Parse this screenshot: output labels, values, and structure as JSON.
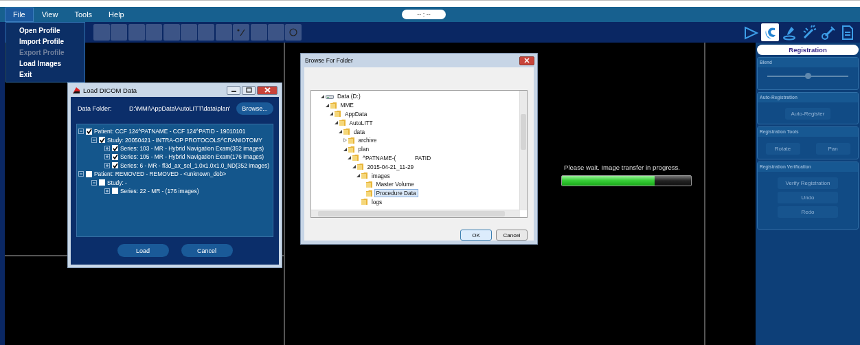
{
  "menu_bar": {
    "items": [
      {
        "label": "File",
        "selected": true
      },
      {
        "label": "View",
        "selected": false
      },
      {
        "label": "Tools",
        "selected": false
      },
      {
        "label": "Help",
        "selected": false
      }
    ],
    "clock": "-- : --"
  },
  "file_menu": {
    "items": [
      {
        "label": "Open Profile",
        "disabled": false
      },
      {
        "label": "Import Profile",
        "disabled": false
      },
      {
        "label": "Export Profile",
        "disabled": true
      },
      {
        "label": "Load Images",
        "disabled": false
      },
      {
        "label": "Exit",
        "disabled": false
      }
    ]
  },
  "toolbar": {
    "tools": [
      {
        "kind": "blank"
      },
      {
        "kind": "blank"
      },
      {
        "kind": "blank"
      },
      {
        "kind": "blank"
      },
      {
        "kind": "blank"
      },
      {
        "kind": "blank"
      },
      {
        "kind": "blank"
      },
      {
        "kind": "blank"
      },
      {
        "kind": "line"
      },
      {
        "kind": "blank"
      },
      {
        "kind": "blank"
      },
      {
        "kind": "circle"
      }
    ],
    "modes": [
      {
        "kind": "play",
        "selected": false
      },
      {
        "kind": "registration",
        "selected": true
      },
      {
        "kind": "pen",
        "selected": false
      },
      {
        "kind": "wand",
        "selected": false
      },
      {
        "kind": "probe",
        "selected": false
      },
      {
        "kind": "document",
        "selected": false
      }
    ]
  },
  "load_dicom_dialog": {
    "title": "Load DICOM Data",
    "data_folder_label": "Data Folder:",
    "data_folder": "D:\\MMI\\AppData\\AutoLITT\\data\\plan'",
    "browse_button": "Browse...",
    "tree": [
      {
        "label": "Patient: CCF 124^PATNAME - CCF 124^PATID - 19010101",
        "checked": true,
        "expanded": true,
        "children": [
          {
            "label": "Study: 20050421 - INTRA-OP PROTOCOLS^CRANIOTOMY",
            "checked": true,
            "expanded": true,
            "children": [
              {
                "label": "Series: 103 - MR - Hybrid Navigation Exam(352 images)",
                "checked": true,
                "expanded": false
              },
              {
                "label": "Series: 105 - MR - Hybrid Navigation Exam(176 images)",
                "checked": true,
                "expanded": false
              },
              {
                "label": "Series: 6 - MR - fl3d_ax_sel_1.0x1.0x1.0_ND(352 images)",
                "checked": true,
                "expanded": false
              }
            ]
          }
        ]
      },
      {
        "label": "Patient: REMOVED - REMOVED - <unknown_dob>",
        "checked": false,
        "expanded": true,
        "children": [
          {
            "label": "Study:  -",
            "checked": false,
            "expanded": true,
            "children": [
              {
                "label": "Series: 22 - MR - (176 images)",
                "checked": false,
                "expanded": false
              }
            ]
          }
        ]
      }
    ],
    "buttons": [
      "Load",
      "Cancel"
    ]
  },
  "browse_dialog": {
    "title": "Browse For Folder",
    "tree": [
      {
        "label": "Data (D:)",
        "kind": "drive",
        "expanded": true,
        "selected": false,
        "children": [
          {
            "label": "MME",
            "kind": "folder",
            "expanded": true,
            "selected": false,
            "children": [
              {
                "label": "AppData",
                "kind": "folder",
                "expanded": true,
                "selected": false,
                "children": [
                  {
                    "label": "AutoLITT",
                    "kind": "folder",
                    "expanded": true,
                    "selected": false,
                    "children": [
                      {
                        "label": "data",
                        "kind": "folder",
                        "expanded": true,
                        "selected": false,
                        "children": [
                          {
                            "label": "archive",
                            "kind": "folder",
                            "expanded": false,
                            "selected": false
                          },
                          {
                            "label": "plan",
                            "kind": "folder",
                            "expanded": true,
                            "selected": false,
                            "children": [
                              {
                                "label": "^PATNAME-(            PATID",
                                "kind": "folder",
                                "expanded": true,
                                "selected": false,
                                "children": [
                                  {
                                    "label": "2015-04-21_11-29",
                                    "kind": "folder",
                                    "expanded": true,
                                    "selected": false,
                                    "children": [
                                      {
                                        "label": "images",
                                        "kind": "folder",
                                        "expanded": true,
                                        "selected": false,
                                        "children": [
                                          {
                                            "label": "Master Volume",
                                            "kind": "folder",
                                            "selected": false
                                          },
                                          {
                                            "label": "Procedure Data",
                                            "kind": "folder",
                                            "selected": true
                                          }
                                        ]
                                      },
                                      {
                                        "label": "logs",
                                        "kind": "folder",
                                        "selected": false
                                      }
                                    ]
                                  }
                                ]
                              }
                            ]
                          }
                        ]
                      }
                    ]
                  }
                ]
              }
            ]
          }
        ]
      }
    ],
    "buttons": [
      "OK",
      "Cancel"
    ]
  },
  "transfer": {
    "message": "Please wait. Image transfer in progress.",
    "level": 0.72
  },
  "registration_panel": {
    "title": "Registration",
    "sections": [
      {
        "title": "Blend",
        "kind": "slider",
        "level": 0.5
      },
      {
        "title": "Auto-Registration",
        "kind": "buttons",
        "buttons": [
          {
            "label": "Auto-Register",
            "disabled": true
          }
        ]
      },
      {
        "title": "Registration Tools",
        "kind": "row",
        "buttons": [
          {
            "label": "Rotate",
            "disabled": true
          },
          {
            "label": "Pan",
            "disabled": true
          }
        ]
      },
      {
        "title": "Registration Verification",
        "kind": "buttons",
        "buttons": [
          {
            "label": "Verify Registration",
            "disabled": true
          },
          {
            "label": "Undo",
            "disabled": true
          },
          {
            "label": "Redo",
            "disabled": true
          }
        ]
      }
    ]
  }
}
